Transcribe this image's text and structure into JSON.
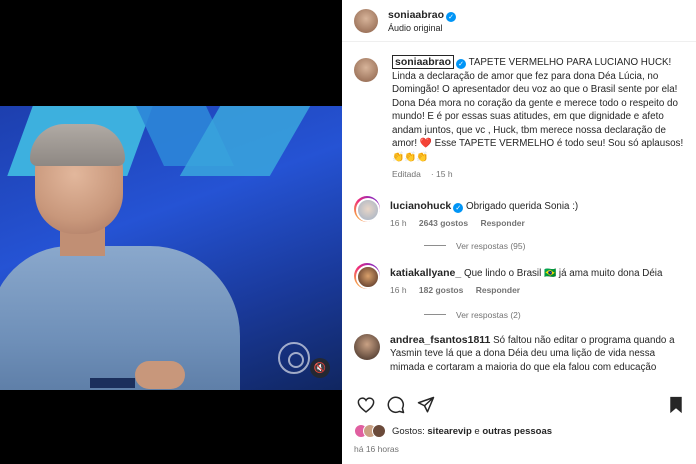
{
  "post": {
    "username": "soniaabrao",
    "audio": "Áudio original"
  },
  "caption": {
    "username": "soniaabrao",
    "text": "TAPETE VERMELHO PARA LUCIANO HUCK! Linda a declaração de amor que fez para dona Déa Lúcia, no Domingão! O apresentador deu voz ao que o Brasil sente por ela! Dona Déa mora no coração da gente e merece todo o respeito do mundo! E é por essas suas atitudes, em que dignidade e afeto andam juntos, que vc , Huck, tbm merece nossa declaração de amor! ❤️ Esse TAPETE VERMELHO é todo seu! Sou só aplausos! 👏👏👏",
    "extra_claps": "👏👏👏",
    "edited": "Editada",
    "time": "15 h"
  },
  "comments": [
    {
      "username": "lucianohuck",
      "verified": true,
      "text": "Obrigado querida Sonia :)",
      "time": "16 h",
      "likes": "2643 gostos",
      "reply": "Responder",
      "view_replies": "Ver respostas (95)"
    },
    {
      "username": "katiakallyane_",
      "verified": false,
      "text": "Que lindo o Brasil 🇧🇷 já ama muito dona Déia",
      "time": "16 h",
      "likes": "182 gostos",
      "reply": "Responder",
      "view_replies": "Ver respostas (2)"
    },
    {
      "username": "andrea_fsantos1811",
      "verified": false,
      "text": "Só faltou não editar o programa quando a Yasmin teve lá que a dona Déia deu uma lição de vida nessa mimada e cortaram a maioria do que ela falou com educação"
    }
  ],
  "footer": {
    "likes_prefix": "Gostos:",
    "likes_user": "sitearevip",
    "likes_suffix": "e",
    "likes_others": "outras pessoas",
    "posted": "há 16 horas"
  },
  "icons": [
    "heart-icon",
    "comment-icon",
    "share-icon",
    "bookmark-icon",
    "mute-icon",
    "verified-icon"
  ],
  "colors": {
    "verified": "#0095f6",
    "meta": "#737373",
    "text": "#262626"
  }
}
